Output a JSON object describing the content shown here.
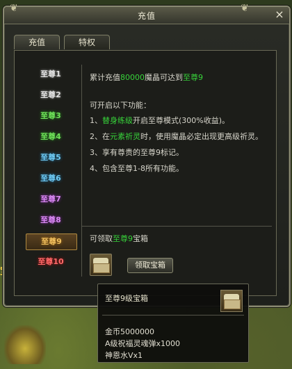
{
  "window": {
    "title": "充值",
    "close_icon": "×"
  },
  "tabs": [
    {
      "label": "充值"
    },
    {
      "label": "特权"
    }
  ],
  "levels": [
    {
      "label": "至尊1"
    },
    {
      "label": "至尊2"
    },
    {
      "label": "至尊3"
    },
    {
      "label": "至尊4"
    },
    {
      "label": "至尊5"
    },
    {
      "label": "至尊6"
    },
    {
      "label": "至尊7"
    },
    {
      "label": "至尊8"
    },
    {
      "label": "至尊9"
    },
    {
      "label": "至尊10"
    }
  ],
  "detail": {
    "requirement": {
      "prefix": "累计充值",
      "amount": "80000",
      "middle": "魔晶可达到",
      "level": "至尊9"
    },
    "features_heading": "可开启以下功能：",
    "features": [
      {
        "prefix": "1、",
        "highlight": "替身练级",
        "rest": "开启至尊模式(300%收益)。"
      },
      {
        "prefix": "2、在",
        "highlight": "元素祈灵",
        "rest": "时，使用魔晶必定出现更高级祈灵。"
      },
      {
        "prefix": "3、",
        "highlight": "",
        "rest": "享有尊贵的至尊9标记。"
      },
      {
        "prefix": "4、",
        "highlight": "",
        "rest": "包含至尊1-8所有功能。"
      }
    ],
    "reward_line": {
      "prefix": "可领取",
      "level": "至尊9",
      "suffix": "宝箱"
    },
    "claim_button": "领取宝箱"
  },
  "tooltip": {
    "title": "至尊9级宝箱",
    "items": [
      "金币5000000",
      "A级祝福灵魂弹x1000",
      "神恩水Vx1"
    ]
  },
  "background": {
    "side_char": "宝"
  },
  "colors": {
    "highlight_green": "#37d43a",
    "window_border": "#8a8a72"
  }
}
